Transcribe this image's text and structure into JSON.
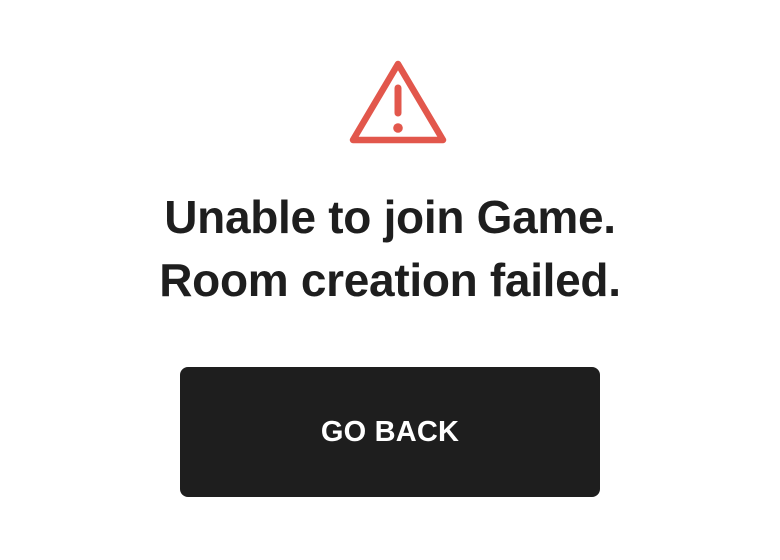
{
  "error": {
    "icon": "warning-triangle-icon",
    "icon_color": "#e2574c",
    "message_line_1": "Unable to join Game.",
    "message_line_2": "Room creation failed."
  },
  "actions": {
    "go_back_label": "GO BACK",
    "button_color": "#1e1e1e",
    "button_text_color": "#ffffff"
  }
}
